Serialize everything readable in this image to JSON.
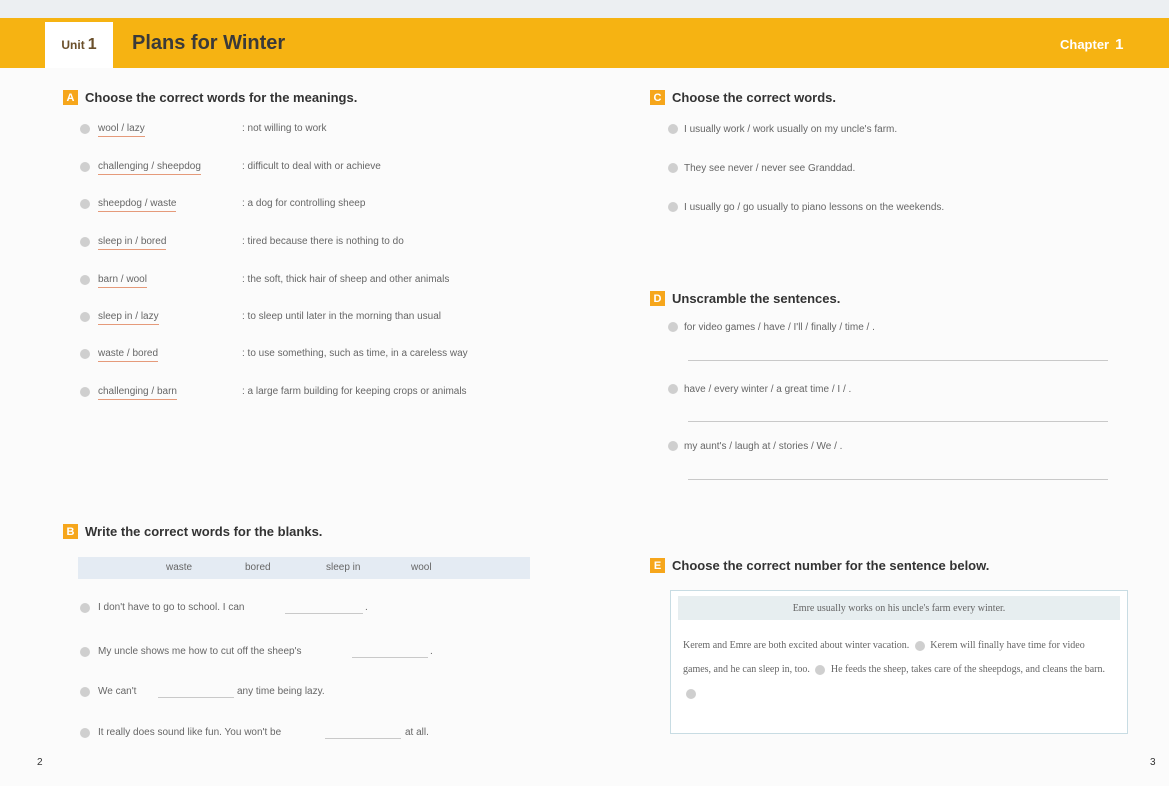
{
  "header": {
    "unit_label": "Unit",
    "unit_number": "1",
    "title": "Plans for Winter",
    "chapter_label": "Chapter",
    "chapter_number": "1"
  },
  "sections": {
    "a": {
      "badge": "A",
      "title": "Choose the correct words for the meanings.",
      "items": [
        {
          "opt1": "wool",
          "opt2": "lazy",
          "meaning": ": not willing to work"
        },
        {
          "opt1": "challenging",
          "opt2": "sheepdog",
          "meaning": ": difficult to deal with or achieve"
        },
        {
          "opt1": "sheepdog",
          "opt2": "waste",
          "meaning": ": a dog for controlling sheep"
        },
        {
          "opt1": "sleep in",
          "opt2": "bored",
          "meaning": ": tired because there is nothing to do"
        },
        {
          "opt1": "barn",
          "opt2": "wool",
          "meaning": ": the soft, thick hair of sheep and other animals"
        },
        {
          "opt1": "sleep in",
          "opt2": "lazy",
          "meaning": ": to sleep until later in the morning than usual"
        },
        {
          "opt1": "waste",
          "opt2": "bored",
          "meaning": ": to use something, such as time, in a careless way"
        },
        {
          "opt1": "challenging",
          "opt2": "barn",
          "meaning": ": a large farm building for keeping crops or animals"
        }
      ]
    },
    "b": {
      "badge": "B",
      "title": "Write the correct words for the blanks.",
      "word_bank": [
        "waste",
        "bored",
        "sleep in",
        "wool"
      ],
      "items": [
        {
          "before": "I don't have to go to school. I can",
          "after": "."
        },
        {
          "before": "My uncle shows me how to cut off the sheep's",
          "after": "."
        },
        {
          "before": "We can't",
          "after": "any time being lazy."
        },
        {
          "before": "It really does sound like fun. You won't be",
          "after": "at all."
        }
      ]
    },
    "c": {
      "badge": "C",
      "title": "Choose the correct words.",
      "items": [
        {
          "before": "I",
          "opt1": "usually work",
          "opt2": "work usually",
          "after": "on my uncle's farm."
        },
        {
          "before": "They",
          "opt1": "see never",
          "opt2": "never see",
          "after": "Granddad."
        },
        {
          "before": "I",
          "opt1": "usually go",
          "opt2": "go usually",
          "after": "to piano lessons on the weekends."
        }
      ]
    },
    "d": {
      "badge": "D",
      "title": "Unscramble the sentences.",
      "items": [
        "for video games / have / I'll / finally / time / .",
        "have / every winter / a great time / I / .",
        "my aunt's / laugh at / stories / We / ."
      ]
    },
    "e": {
      "badge": "E",
      "title": "Choose the correct number for the sentence below.",
      "sentence": "Emre usually works on his uncle's farm every winter.",
      "passage": {
        "p1": "Kerem and Emre are both excited about winter vacation.",
        "p2": "Kerem will finally have time for video games, and he can sleep in, too.",
        "p3": "He feeds the sheep, takes care of the sheepdogs, and cleans the barn."
      }
    }
  },
  "page_numbers": {
    "left": "2",
    "right": "3"
  }
}
